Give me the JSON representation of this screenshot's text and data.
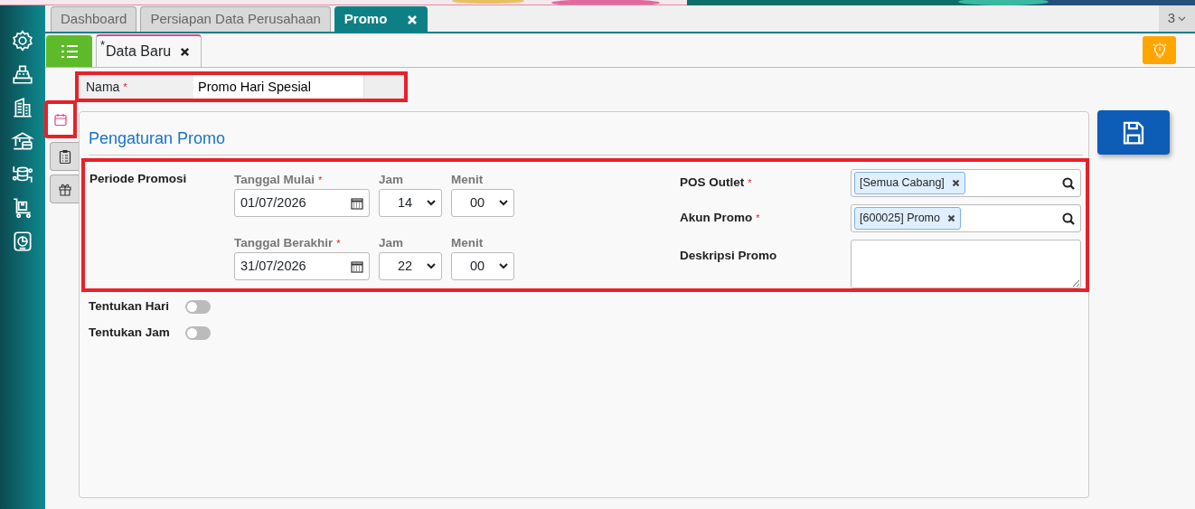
{
  "top_tabs": [
    {
      "label": "Dashboard",
      "selected": false,
      "closable": false
    },
    {
      "label": "Persiapan Data Perusahaan",
      "selected": false,
      "closable": false
    },
    {
      "label": "Promo",
      "selected": true,
      "closable": true
    }
  ],
  "tab_count": "3",
  "sub_tabs": [
    {
      "label": "Data Baru",
      "prefix": "*",
      "selected": true,
      "closable": true
    }
  ],
  "name_field": {
    "label": "Nama",
    "required_mark": "*",
    "value": "Promo Hari Spesial",
    "highlighted": true
  },
  "side_tabs": [
    {
      "selected": true,
      "highlighted": true
    },
    {
      "selected": false,
      "highlighted": false
    },
    {
      "selected": false,
      "highlighted": false
    }
  ],
  "section_title": "Pengaturan Promo",
  "details": {
    "highlighted": true,
    "label": "Periode Promosi",
    "periods": [
      {
        "date_label": "Tanggal Mulai",
        "required_mark": "*",
        "date": "01/07/2026",
        "hour_label": "Jam",
        "hour": "14",
        "minute_label": "Menit",
        "minute": "00"
      },
      {
        "date_label": "Tanggal Berakhir",
        "required_mark": "*",
        "date": "31/07/2026",
        "hour_label": "Jam",
        "hour": "22",
        "minute_label": "Menit",
        "minute": "00"
      }
    ],
    "fields": [
      {
        "kind": "tags",
        "label": "POS Outlet",
        "required_mark": "*",
        "tags": [
          "[Semua Cabang]"
        ]
      },
      {
        "kind": "tags",
        "label": "Akun Promo",
        "required_mark": "*",
        "tags": [
          "[600025] Promo"
        ]
      },
      {
        "kind": "textarea",
        "label": "Deskripsi Promo"
      }
    ]
  },
  "toggles": [
    {
      "label": "Tentukan Hari",
      "on": false
    },
    {
      "label": "Tentukan Jam",
      "on": false
    }
  ]
}
